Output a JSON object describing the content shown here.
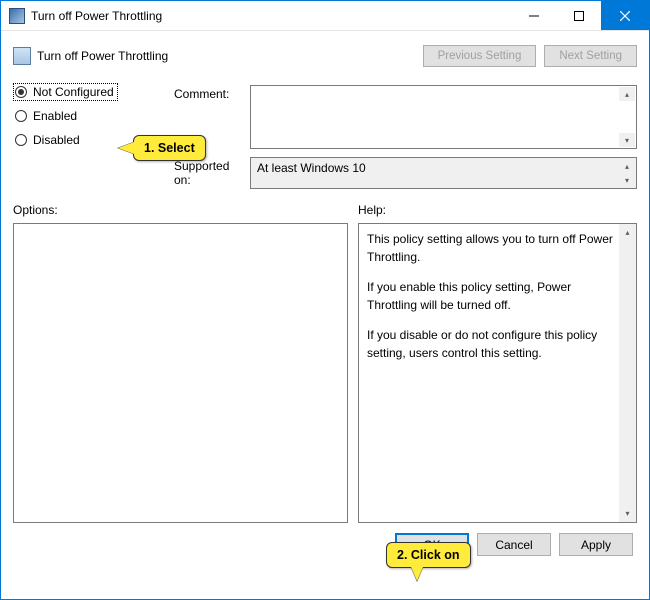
{
  "window": {
    "title": "Turn off Power Throttling"
  },
  "header": {
    "policy_title": "Turn off Power Throttling",
    "prev": "Previous Setting",
    "next": "Next Setting"
  },
  "radios": {
    "not_configured": "Not Configured",
    "enabled": "Enabled",
    "disabled": "Disabled",
    "selected": "not_configured"
  },
  "labels": {
    "comment": "Comment:",
    "supported": "Supported on:",
    "options": "Options:",
    "help": "Help:"
  },
  "supported_text": "At least Windows 10",
  "help": {
    "p1": "This policy setting allows you to turn off Power Throttling.",
    "p2": "If you enable this policy setting, Power Throttling will be turned off.",
    "p3": "If you disable or do not configure this policy setting, users control this setting."
  },
  "buttons": {
    "ok": "OK",
    "cancel": "Cancel",
    "apply": "Apply"
  },
  "annotations": {
    "a1": "1. Select",
    "a2": "2. Click on"
  }
}
